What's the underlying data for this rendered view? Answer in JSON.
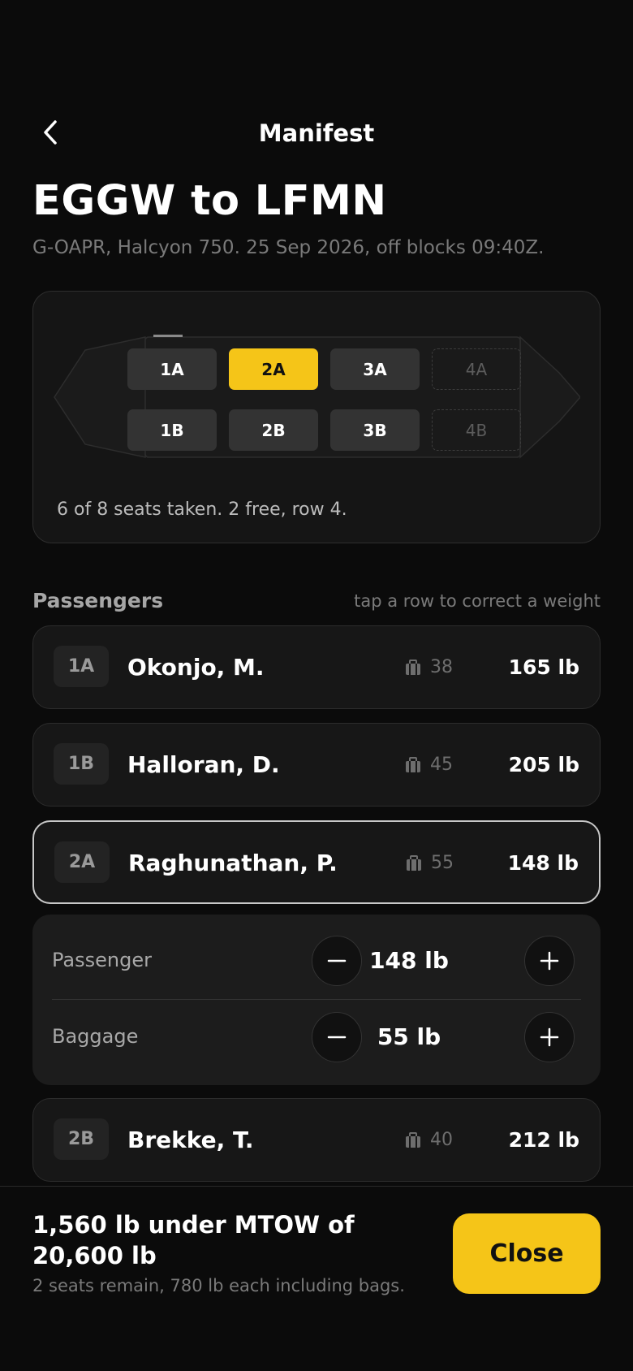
{
  "nav": {
    "title": "Manifest"
  },
  "flight": {
    "route": "EGGW to LFMN",
    "details": "G-OAPR, Halcyon 750. 25 Sep 2026, off blocks 09:40Z."
  },
  "seatmap": {
    "seats": [
      {
        "id": "1A",
        "state": "taken"
      },
      {
        "id": "2A",
        "state": "selected"
      },
      {
        "id": "3A",
        "state": "taken"
      },
      {
        "id": "4A",
        "state": "free"
      },
      {
        "id": "1B",
        "state": "taken"
      },
      {
        "id": "2B",
        "state": "taken"
      },
      {
        "id": "3B",
        "state": "taken"
      },
      {
        "id": "4B",
        "state": "free"
      }
    ],
    "summary": "6 of 8 seats taken. 2 free, row 4."
  },
  "passengers": {
    "heading": "Passengers",
    "hint": "tap a row to correct a weight",
    "rows": [
      {
        "seat": "1A",
        "name": "Okonjo, M.",
        "bag": "38",
        "weight": "165 lb"
      },
      {
        "seat": "1B",
        "name": "Halloran, D.",
        "bag": "45",
        "weight": "205 lb"
      },
      {
        "seat": "2A",
        "name": "Raghunathan, P.",
        "bag": "55",
        "weight": "148 lb"
      },
      {
        "seat": "2B",
        "name": "Brekke, T.",
        "bag": "40",
        "weight": "212 lb"
      }
    ]
  },
  "editor": {
    "passenger_label": "Passenger",
    "passenger_value": "148 lb",
    "baggage_label": "Baggage",
    "baggage_value": "55 lb"
  },
  "footer": {
    "title": "1,560 lb under MTOW of 20,600 lb",
    "subtitle": "2 seats remain, 780 lb each including bags.",
    "close_label": "Close"
  },
  "colors": {
    "accent": "#f5c518",
    "background": "#0b0b0b",
    "card": "#171717"
  }
}
